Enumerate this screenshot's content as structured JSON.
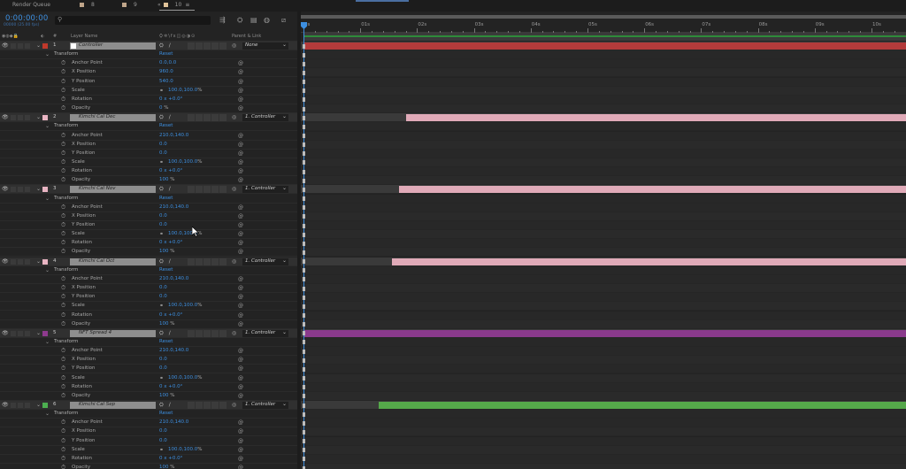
{
  "tabs": [
    {
      "label": "Render Queue",
      "swatch": ""
    },
    {
      "label": "8",
      "swatch": "#bfa58a"
    },
    {
      "label": "9",
      "swatch": "#bfa58a"
    },
    {
      "label": "10",
      "swatch": "#e0c39a"
    }
  ],
  "tab_prefix": "«",
  "tab_menu": "≡",
  "timecode": "0:00:00:00",
  "fps": "00000 (25.00 fps)",
  "search_icon": "search-icon",
  "column_headers": {
    "eye": "👁",
    "hash": "#",
    "layer_name": "Layer Name",
    "parent": "Parent & Link"
  },
  "reset_label": "Reset",
  "transform_label": "Transform",
  "layers": [
    {
      "num": "1",
      "name": "Controller",
      "color": "#c0392b",
      "parent": "None",
      "bar_color": "#b33b3b",
      "bar_start": 0.0,
      "props": {
        "anchor": "0.0,0.0",
        "x": "960.0",
        "y": "540.0",
        "scale": "100.0,100.0",
        "rotation": "0 x +0.0°",
        "opacity": "0"
      }
    },
    {
      "num": "2",
      "name": "Kimchi Cal Dec",
      "color": "#e8b4c2",
      "parent": "1. Controller",
      "bar_color": "#e0aab8",
      "bar_start": 1.8,
      "props": {
        "anchor": "210.0,140.0",
        "x": "0.0",
        "y": "0.0",
        "scale": "100.0,100.0",
        "rotation": "0 x +0.0°",
        "opacity": "100"
      }
    },
    {
      "num": "3",
      "name": "Kimchi Cal Nov",
      "color": "#e8b4c2",
      "parent": "1. Controller",
      "bar_color": "#e0aab8",
      "bar_start": 1.68,
      "props": {
        "anchor": "210.0,140.0",
        "x": "0.0",
        "y": "0.0",
        "scale": "100.0,100.0",
        "rotation": "0 x +0.0°",
        "opacity": "100"
      }
    },
    {
      "num": "4",
      "name": "Kimchi Cal Oct",
      "color": "#e8b4c2",
      "parent": "1. Controller",
      "bar_color": "#e0aab8",
      "bar_start": 1.56,
      "props": {
        "anchor": "210.0,140.0",
        "x": "0.0",
        "y": "0.0",
        "scale": "100.0,100.0",
        "rotation": "0 x +0.0°",
        "opacity": "100"
      }
    },
    {
      "num": "5",
      "name": "NFT Spread 4",
      "color": "#8e3a8e",
      "parent": "1. Controller",
      "bar_color": "#8a3a8c",
      "bar_start": 0.0,
      "props": {
        "anchor": "210.0,140.0",
        "x": "0.0",
        "y": "0.0",
        "scale": "100.0,100.0",
        "rotation": "0 x +0.0°",
        "opacity": "100"
      }
    },
    {
      "num": "6",
      "name": "Kimchi Cal Sep",
      "color": "#4caf50",
      "parent": "1. Controller",
      "bar_color": "#55a84a",
      "bar_start": 1.32,
      "props": {
        "anchor": "210.0,140.0",
        "x": "0.0",
        "y": "0.0",
        "scale": "100.0,100.0",
        "rotation": "0 x +0.0°",
        "opacity": "100"
      }
    }
  ],
  "prop_labels": {
    "anchor": "Anchor Point",
    "x": "X Position",
    "y": "Y Position",
    "scale": "Scale",
    "rotation": "Rotation",
    "opacity": "Opacity"
  },
  "percent_unit": "%",
  "ruler_ticks": [
    "0s",
    "01s",
    "02s",
    "03s",
    "04s",
    "05s",
    "06s",
    "07s",
    "08s",
    "09s",
    "10s"
  ],
  "colors": {
    "accent_blue": "#3d8fe0",
    "work_area_green": "#2e8b3a"
  }
}
